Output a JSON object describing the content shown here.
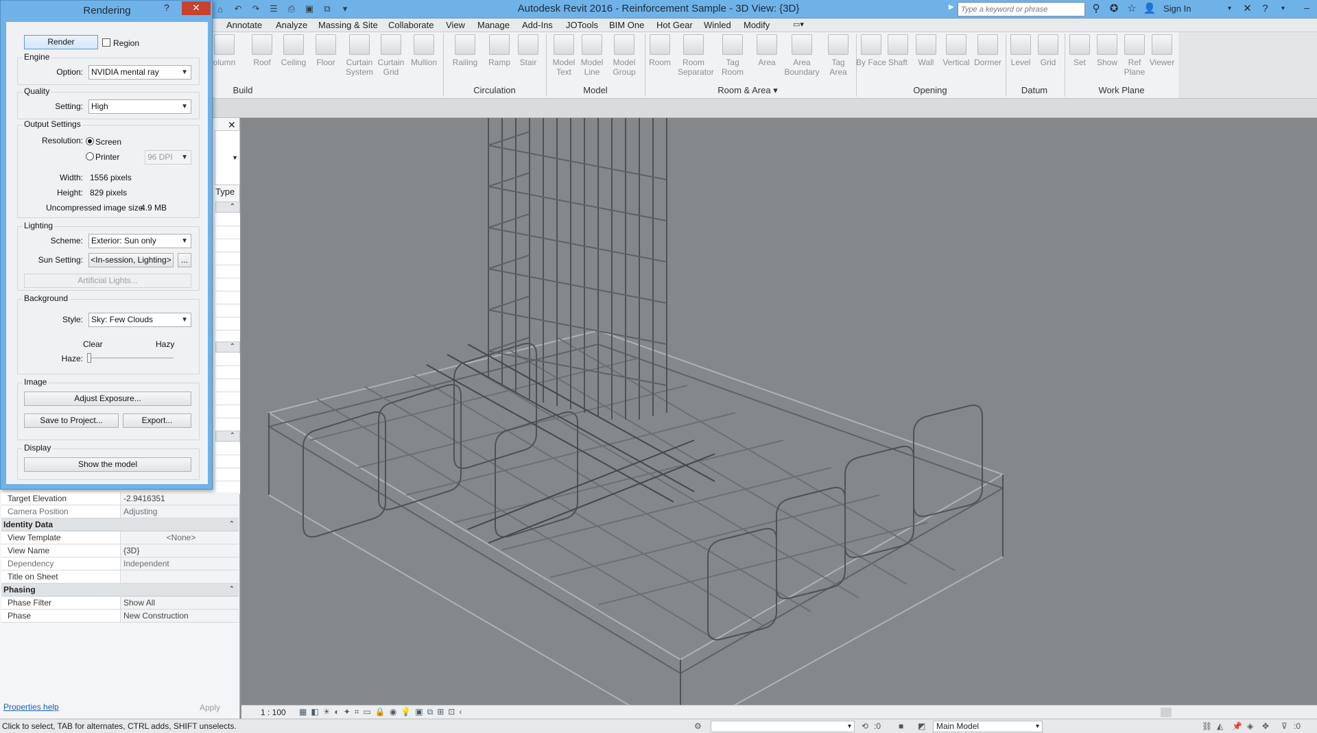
{
  "app": {
    "title": "Autodesk Revit 2016 -     Reinforcement Sample - 3D View: {3D}",
    "search_placeholder": "Type a keyword or phrase",
    "sign_in": "Sign In"
  },
  "menu_tabs": [
    "Annotate",
    "Analyze",
    "Massing & Site",
    "Collaborate",
    "View",
    "Manage",
    "Add-Ins",
    "JOTools",
    "BIM One",
    "Hot Gear",
    "Winled",
    "Modify"
  ],
  "ribbon": {
    "buttons": [
      {
        "label": "olumn",
        "icon": "column-icon"
      },
      {
        "label": "Roof",
        "icon": "roof-icon"
      },
      {
        "label": "Ceiling",
        "icon": "ceiling-icon"
      },
      {
        "label": "Floor",
        "icon": "floor-icon"
      },
      {
        "label": "Curtain System",
        "icon": "curtain-system-icon"
      },
      {
        "label": "Curtain Grid",
        "icon": "curtain-grid-icon"
      },
      {
        "label": "Mullion",
        "icon": "mullion-icon"
      },
      {
        "label": "Railing",
        "icon": "railing-icon"
      },
      {
        "label": "Ramp",
        "icon": "ramp-icon"
      },
      {
        "label": "Stair",
        "icon": "stair-icon"
      },
      {
        "label": "Model Text",
        "icon": "model-text-icon"
      },
      {
        "label": "Model Line",
        "icon": "model-line-icon"
      },
      {
        "label": "Model Group",
        "icon": "model-group-icon"
      },
      {
        "label": "Room",
        "icon": "room-icon"
      },
      {
        "label": "Room Separator",
        "icon": "room-separator-icon"
      },
      {
        "label": "Tag Room",
        "icon": "tag-room-icon"
      },
      {
        "label": "Area",
        "icon": "area-icon"
      },
      {
        "label": "Area Boundary",
        "icon": "area-boundary-icon"
      },
      {
        "label": "Tag Area",
        "icon": "tag-area-icon"
      },
      {
        "label": "By Face",
        "icon": "by-face-icon"
      },
      {
        "label": "Shaft",
        "icon": "shaft-icon"
      },
      {
        "label": "Wall",
        "icon": "wall-opening-icon"
      },
      {
        "label": "Vertical",
        "icon": "vertical-icon"
      },
      {
        "label": "Dormer",
        "icon": "dormer-icon"
      },
      {
        "label": "Level",
        "icon": "level-icon"
      },
      {
        "label": "Grid",
        "icon": "grid-icon"
      },
      {
        "label": "Set",
        "icon": "set-icon"
      },
      {
        "label": "Show",
        "icon": "show-icon"
      },
      {
        "label": "Ref Plane",
        "icon": "ref-plane-icon"
      },
      {
        "label": "Viewer",
        "icon": "viewer-icon"
      }
    ],
    "panels": [
      "Build",
      "Circulation",
      "Model",
      "Room & Area ▾",
      "Opening",
      "Datum",
      "Work Plane"
    ]
  },
  "properties": {
    "type_label": "Type",
    "rows_top": [
      {
        "key": "Target Elevation",
        "value": "-2.9416351",
        "gray": false
      },
      {
        "key": "Camera Position",
        "value": "Adjusting",
        "gray": true
      }
    ],
    "identity_group": "Identity Data",
    "identity_rows": [
      {
        "key": "View Template",
        "value": "<None>",
        "gray": false,
        "center": true
      },
      {
        "key": "View Name",
        "value": "{3D}",
        "gray": false
      },
      {
        "key": "Dependency",
        "value": "Independent",
        "gray": true
      },
      {
        "key": "Title on Sheet",
        "value": "",
        "gray": false
      }
    ],
    "phasing_group": "Phasing",
    "phasing_rows": [
      {
        "key": "Phase Filter",
        "value": "Show All",
        "gray": false
      },
      {
        "key": "Phase",
        "value": "New Construction",
        "gray": false
      }
    ],
    "help_link": "Properties help",
    "apply": "Apply"
  },
  "rendering_dialog": {
    "title": "Rendering",
    "render_button": "Render",
    "region_label": "Region",
    "engine": {
      "group": "Engine",
      "option_label": "Option:",
      "option_value": "NVIDIA mental ray"
    },
    "quality": {
      "group": "Quality",
      "setting_label": "Setting:",
      "setting_value": "High"
    },
    "output": {
      "group": "Output Settings",
      "resolution_label": "Resolution:",
      "screen": "Screen",
      "printer": "Printer",
      "dpi": "96 DPI",
      "width_label": "Width:",
      "width_value": "1556 pixels",
      "height_label": "Height:",
      "height_value": "829 pixels",
      "size_label": "Uncompressed image size:",
      "size_value": "4.9 MB"
    },
    "lighting": {
      "group": "Lighting",
      "scheme_label": "Scheme:",
      "scheme_value": "Exterior: Sun only",
      "sun_label": "Sun Setting:",
      "sun_value": "<In-session, Lighting>",
      "sun_more": "...",
      "artificial": "Artificial Lights..."
    },
    "background": {
      "group": "Background",
      "style_label": "Style:",
      "style_value": "Sky: Few Clouds",
      "clear": "Clear",
      "hazy": "Hazy",
      "haze_label": "Haze:",
      "haze_level": 0
    },
    "image": {
      "group": "Image",
      "adjust": "Adjust Exposure...",
      "save": "Save to Project...",
      "export": "Export..."
    },
    "display": {
      "group": "Display",
      "show_model": "Show the model"
    }
  },
  "viewbar": {
    "scale": "1 : 100"
  },
  "statusbar": {
    "message": "Click to select, TAB for alternates, CTRL adds, SHIFT unselects.",
    "coord": ":0",
    "model": "Main Model",
    "filter_count": ":0"
  },
  "colors": {
    "titlebar": "#6fb2e8",
    "close": "#c7412f",
    "viewport": "#84888b"
  }
}
